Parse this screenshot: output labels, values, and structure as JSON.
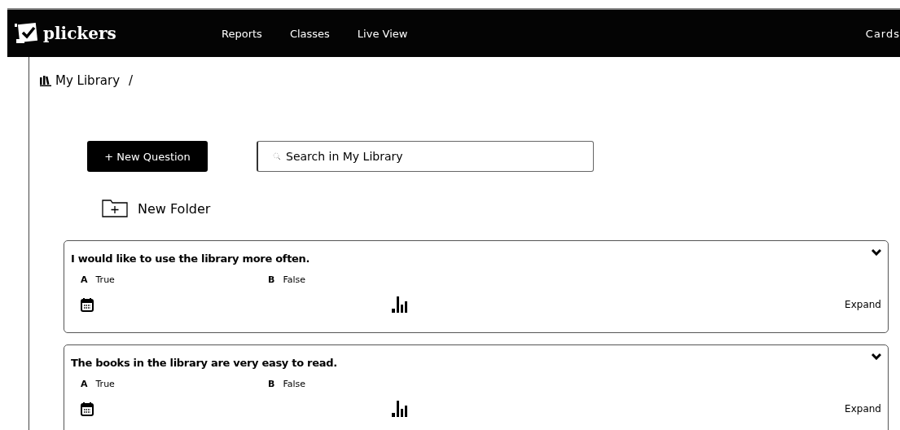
{
  "nav": {
    "brand": "plickers",
    "links": [
      "Reports",
      "Classes",
      "Live View"
    ],
    "right_link": "Cards"
  },
  "breadcrumb": {
    "label": "My Library",
    "separator": "/"
  },
  "new_question_button": "+ New Question",
  "search": {
    "placeholder": "Search in My Library"
  },
  "new_folder": "New Folder",
  "questions": [
    {
      "text": "I would like to use the library more often.",
      "choices": [
        {
          "letter": "A",
          "text": "True"
        },
        {
          "letter": "B",
          "text": "False"
        }
      ],
      "expand": "Expand"
    },
    {
      "text": "The books in the library are very easy to read.",
      "choices": [
        {
          "letter": "A",
          "text": "True"
        },
        {
          "letter": "B",
          "text": "False"
        }
      ],
      "expand": "Expand"
    }
  ]
}
